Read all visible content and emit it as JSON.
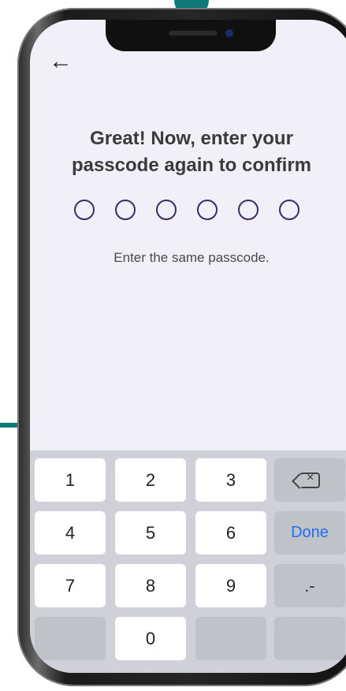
{
  "header": {
    "back_icon": "arrow-left-icon",
    "title_line1": "Great! Now, enter your",
    "title_line2": "passcode again to confirm"
  },
  "passcode": {
    "digits": 6,
    "filled": 0
  },
  "hint": "Enter the same passcode.",
  "keyboard": {
    "k1": "1",
    "k2": "2",
    "k3": "3",
    "k4": "4",
    "k5": "5",
    "k6": "6",
    "k7": "7",
    "k8": "8",
    "k9": "9",
    "k0": "0",
    "done": "Done",
    "punct": ".-",
    "backspace_icon": "backspace-icon"
  },
  "colors": {
    "accent": "#11787a",
    "dot_border": "#3e2a67",
    "done": "#1f6ff0"
  }
}
